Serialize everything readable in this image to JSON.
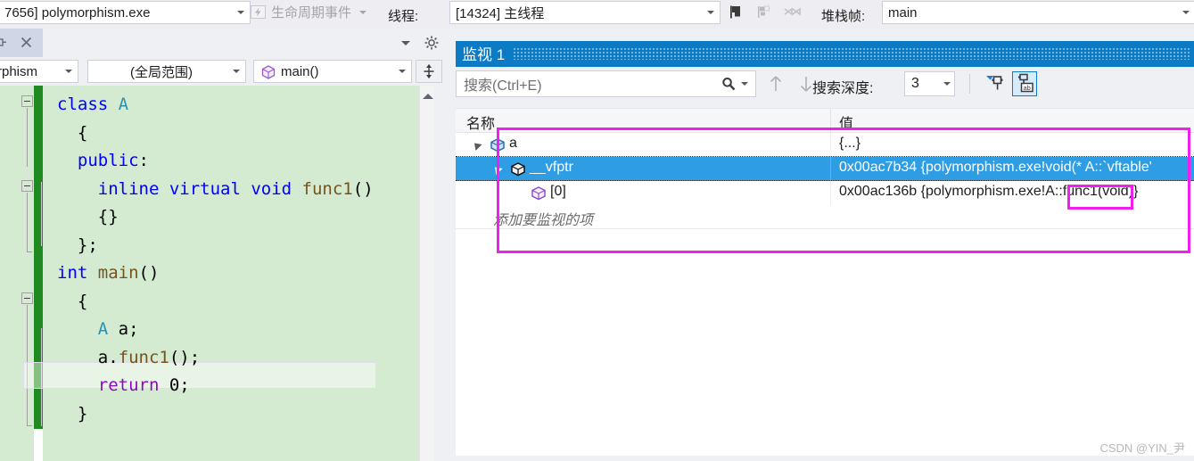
{
  "toolbar": {
    "process": {
      "value": "7656] polymorphism.exe",
      "icon": "chevron-down-icon"
    },
    "lifecycle": {
      "label": "生命周期事件",
      "icon": "lightning-bolt-icon"
    },
    "thread_label": "线程:",
    "thread": {
      "value": "[14324] 主线程"
    },
    "icons": [
      "flag-icon",
      "flag-multiple-icon",
      "threads-icon"
    ],
    "frame_label": "堆栈帧:",
    "frame": {
      "value": "main"
    }
  },
  "editor": {
    "tab": {
      "pin_icon": "pin-icon",
      "close_icon": "close-icon"
    },
    "tabstrip_right": {
      "dropdown_icon": "chevron-down-icon",
      "settings_icon": "gear-icon"
    },
    "nav": {
      "file": "rphism",
      "scope": "(全局范围)",
      "function": "main()",
      "function_icon": "cube-icon",
      "split_icon": "split-window-icon"
    },
    "code_lines": [
      {
        "fold": "minus",
        "tokens": [
          {
            "t": "class ",
            "c": "kw"
          },
          {
            "t": "A",
            "c": "typ"
          }
        ],
        "indent": 0
      },
      {
        "fold": "",
        "tokens": [
          {
            "t": "{",
            "c": "pl"
          }
        ],
        "indent": 1
      },
      {
        "fold": "",
        "tokens": [
          {
            "t": "public",
            "c": "kw"
          },
          {
            "t": ":",
            "c": "pl"
          }
        ],
        "indent": 1
      },
      {
        "fold": "minus",
        "tokens": [
          {
            "t": "inline virtual void ",
            "c": "kw"
          },
          {
            "t": "func1",
            "c": "fn"
          },
          {
            "t": "()",
            "c": "pl"
          }
        ],
        "indent": 2
      },
      {
        "fold": "",
        "tokens": [
          {
            "t": "{}",
            "c": "pl"
          }
        ],
        "indent": 2
      },
      {
        "fold": "",
        "tokens": [
          {
            "t": "};",
            "c": "pl"
          }
        ],
        "indent": 1
      },
      {
        "fold": "minus",
        "tokens": [
          {
            "t": "int ",
            "c": "kw"
          },
          {
            "t": "main",
            "c": "fn"
          },
          {
            "t": "()",
            "c": "pl"
          }
        ],
        "indent": 0
      },
      {
        "fold": "",
        "tokens": [
          {
            "t": "{",
            "c": "pl"
          }
        ],
        "indent": 1
      },
      {
        "fold": "",
        "tokens": [
          {
            "t": "A",
            "c": "typ"
          },
          {
            "t": " a;",
            "c": "pl"
          }
        ],
        "indent": 2
      },
      {
        "fold": "",
        "tokens": [
          {
            "t": "a.",
            "c": "pl"
          },
          {
            "t": "func1",
            "c": "fn"
          },
          {
            "t": "();",
            "c": "pl"
          }
        ],
        "indent": 2,
        "current": true
      },
      {
        "fold": "",
        "tokens": [
          {
            "t": "return ",
            "c": "ctl"
          },
          {
            "t": "0;",
            "c": "pl"
          }
        ],
        "indent": 2
      },
      {
        "fold": "",
        "tokens": [
          {
            "t": "}",
            "c": "pl"
          }
        ],
        "indent": 1
      }
    ],
    "scrollbar": {
      "up_icon": "scroll-up-icon"
    }
  },
  "watch": {
    "tab_label": "监视 1",
    "search": {
      "placeholder": "搜索(Ctrl+E)",
      "icon": "search-icon",
      "dropdown_icon": "chevron-down-icon"
    },
    "prev_icon": "arrow-up-icon",
    "next_icon": "arrow-down-icon",
    "depth_label": "搜索深度:",
    "depth_value": "3",
    "pin_icon": "pin-filter-icon",
    "hex_icon": "hex-display-icon",
    "columns": {
      "name": "名称",
      "value": "值"
    },
    "rows": [
      {
        "name": "a",
        "value": "{...}",
        "icon": "cube-blue-icon",
        "expander": "expanded",
        "indent": 0,
        "selected": false
      },
      {
        "name": "__vfptr",
        "value": "0x00ac7b34 {polymorphism.exe!void(* A::`vftable'",
        "icon": "cube-black-icon",
        "expander": "expanded",
        "indent": 1,
        "selected": true
      },
      {
        "name": "[0]",
        "value": "0x00ac136b {polymorphism.exe!A::func1(void)}",
        "icon": "cube-purple-icon",
        "expander": "",
        "indent": 2,
        "selected": false
      }
    ],
    "add_row_text": "添加要监视的项"
  },
  "annotations": {
    "color": "#ef20ef",
    "boxes": [
      "watch-region-box",
      "func1-highlight-box"
    ]
  },
  "watermark": "CSDN @YIN_尹"
}
